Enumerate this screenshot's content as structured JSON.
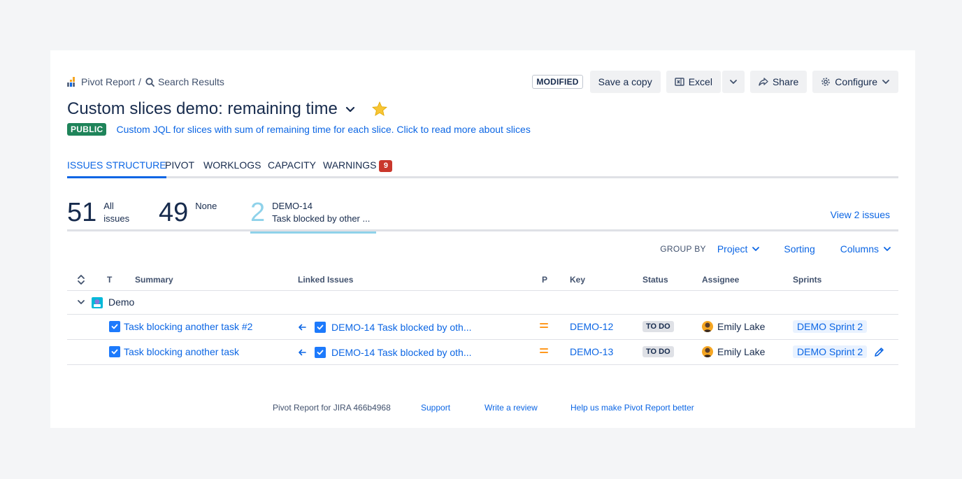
{
  "breadcrumbs": {
    "app": "Pivot Report",
    "separator": "/",
    "current": "Search Results"
  },
  "header": {
    "modified_badge": "MODIFIED",
    "save_copy": "Save a copy",
    "excel": "Excel",
    "share": "Share",
    "configure": "Configure"
  },
  "report": {
    "title": "Custom slices demo: remaining time",
    "visibility": "PUBLIC",
    "description": "Custom JQL for slices with sum of remaining time for each slice. Click to read more about slices"
  },
  "tabs": [
    {
      "label": "ISSUES STRUCTURE",
      "active": true
    },
    {
      "label": "PIVOT"
    },
    {
      "label": "WORKLOGS"
    },
    {
      "label": "CAPACITY"
    },
    {
      "label": "WARNINGS",
      "badge": "9"
    }
  ],
  "slices": [
    {
      "count": "51",
      "line1": "All",
      "line2": "issues"
    },
    {
      "count": "49",
      "line1": "None",
      "line2": ""
    },
    {
      "count": "2",
      "line1": "DEMO-14",
      "line2": "Task blocked by other ...",
      "selected": true
    }
  ],
  "view_issues": "View 2 issues",
  "toolbar": {
    "group_by_label": "GROUP BY",
    "group_by_value": "Project",
    "sorting": "Sorting",
    "columns": "Columns"
  },
  "table": {
    "headers": {
      "type": "T",
      "summary": "Summary",
      "linked": "Linked Issues",
      "priority": "P",
      "key": "Key",
      "status": "Status",
      "assignee": "Assignee",
      "sprints": "Sprints"
    },
    "group": {
      "name": "Demo"
    },
    "rows": [
      {
        "summary": "Task blocking another task #2",
        "linked": "DEMO-14 Task blocked by oth...",
        "key": "DEMO-12",
        "status": "TO DO",
        "assignee": "Emily Lake",
        "sprint": "DEMO Sprint 2"
      },
      {
        "summary": "Task blocking another task",
        "linked": "DEMO-14 Task blocked by oth...",
        "key": "DEMO-13",
        "status": "TO DO",
        "assignee": "Emily Lake",
        "sprint": "DEMO Sprint 2"
      }
    ]
  },
  "footer": {
    "version": "Pivot Report for JIRA 466b4968",
    "support": "Support",
    "review": "Write a review",
    "feedback": "Help us make Pivot Report better"
  },
  "colors": {
    "link": "#0c66e4",
    "public_badge": "#1f845a",
    "warning_badge": "#c9372c",
    "slice_selected": "#8fd2ea",
    "priority_medium": "#ff991f"
  }
}
